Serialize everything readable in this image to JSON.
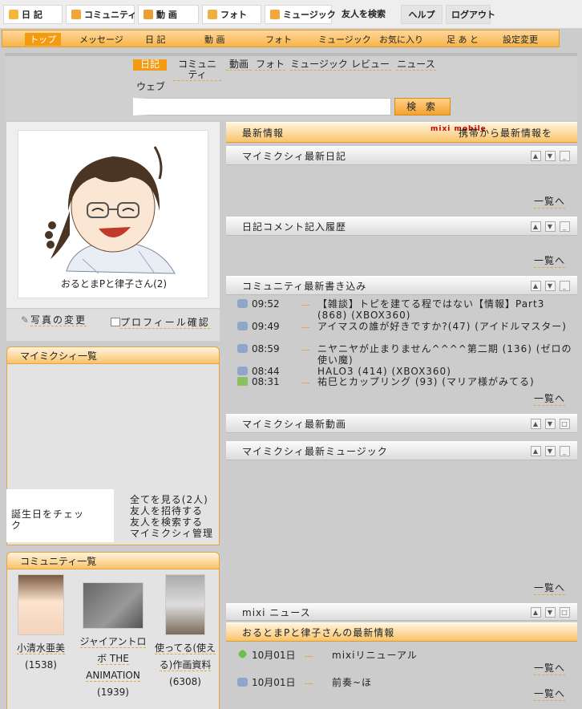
{
  "topbar": {
    "items": [
      "日 記",
      "コミュニティ",
      "動 画",
      "フォト",
      "ミュージック"
    ],
    "search_friends": "友人を検索",
    "help": "ヘルプ",
    "logout": "ログアウト"
  },
  "subnav": [
    "トップ",
    "メッセージ",
    "日 記",
    "動 画",
    "フォト",
    "ミュージック",
    "お気に入り",
    "足 あ と",
    "設定変更"
  ],
  "search": {
    "tabs": [
      "日記",
      "コミュニティ",
      "動画",
      "フォト",
      "ミュージック",
      "レビュー",
      "ニュース",
      "ウェブ"
    ],
    "input_value": "",
    "button": "検 索"
  },
  "profile": {
    "name": "おるとまPと律子さん(2)",
    "change_photo": "写真の変更",
    "view_profile": "プロフィール確認"
  },
  "mymixi": {
    "title": "マイミクシィ一覧",
    "birthday": "誕生日をチェック",
    "links": [
      "全てを見る(2人)",
      "友人を招待する",
      "友人を検索する",
      "マイミクシィ管理"
    ]
  },
  "community": {
    "title": "コミュニティ一覧",
    "items": [
      {
        "name": "小清水亜美",
        "count": "(1538)"
      },
      {
        "name": "ジャイアントロボ THE ANIMATION",
        "count": "(1939)"
      },
      {
        "name": "使ってる(使える)作画資料",
        "count": "(6308)"
      }
    ]
  },
  "right": {
    "news_title": "最新情報",
    "mobile_label": "mixi mobile",
    "mobile_text": "携帯から最新情報を",
    "sections": {
      "diary": "マイミクシィ最新日記",
      "comment_history": "日記コメント記入履歴",
      "community_posts": "コミュニティ最新書き込み",
      "video": "マイミクシィ最新動画",
      "music": "マイミクシィ最新ミュージック",
      "mixi_news": "mixi ニュース",
      "my_updates": "おるとまPと律子さんの最新情報"
    },
    "more": "一覧へ",
    "community_rows": [
      {
        "time": "09:52",
        "title": "【雑談】トピを建てる程ではない【情報】Part3 (868) (XBOX360)"
      },
      {
        "time": "09:49",
        "title": "アイマスの誰が好きですか?(47) (アイドルマスター)"
      },
      {
        "time": "08:59",
        "title": "ニヤニヤが止まりません^^^^第二期 (136) (ゼロの使い魔)"
      },
      {
        "time": "08:44",
        "title": "HALO3 (414) (XBOX360)"
      },
      {
        "time": "08:31",
        "title": "祐巳とカップリング (93) (マリア様がみてる)"
      }
    ],
    "updates": [
      {
        "date": "10月01日",
        "title": "mixiリニューアル"
      },
      {
        "date": "10月01日",
        "title": "前奏~ほ"
      }
    ]
  },
  "colors": {
    "accent": "#f39c12",
    "accent_light": "#f9c46c",
    "background": "#cccccc"
  }
}
